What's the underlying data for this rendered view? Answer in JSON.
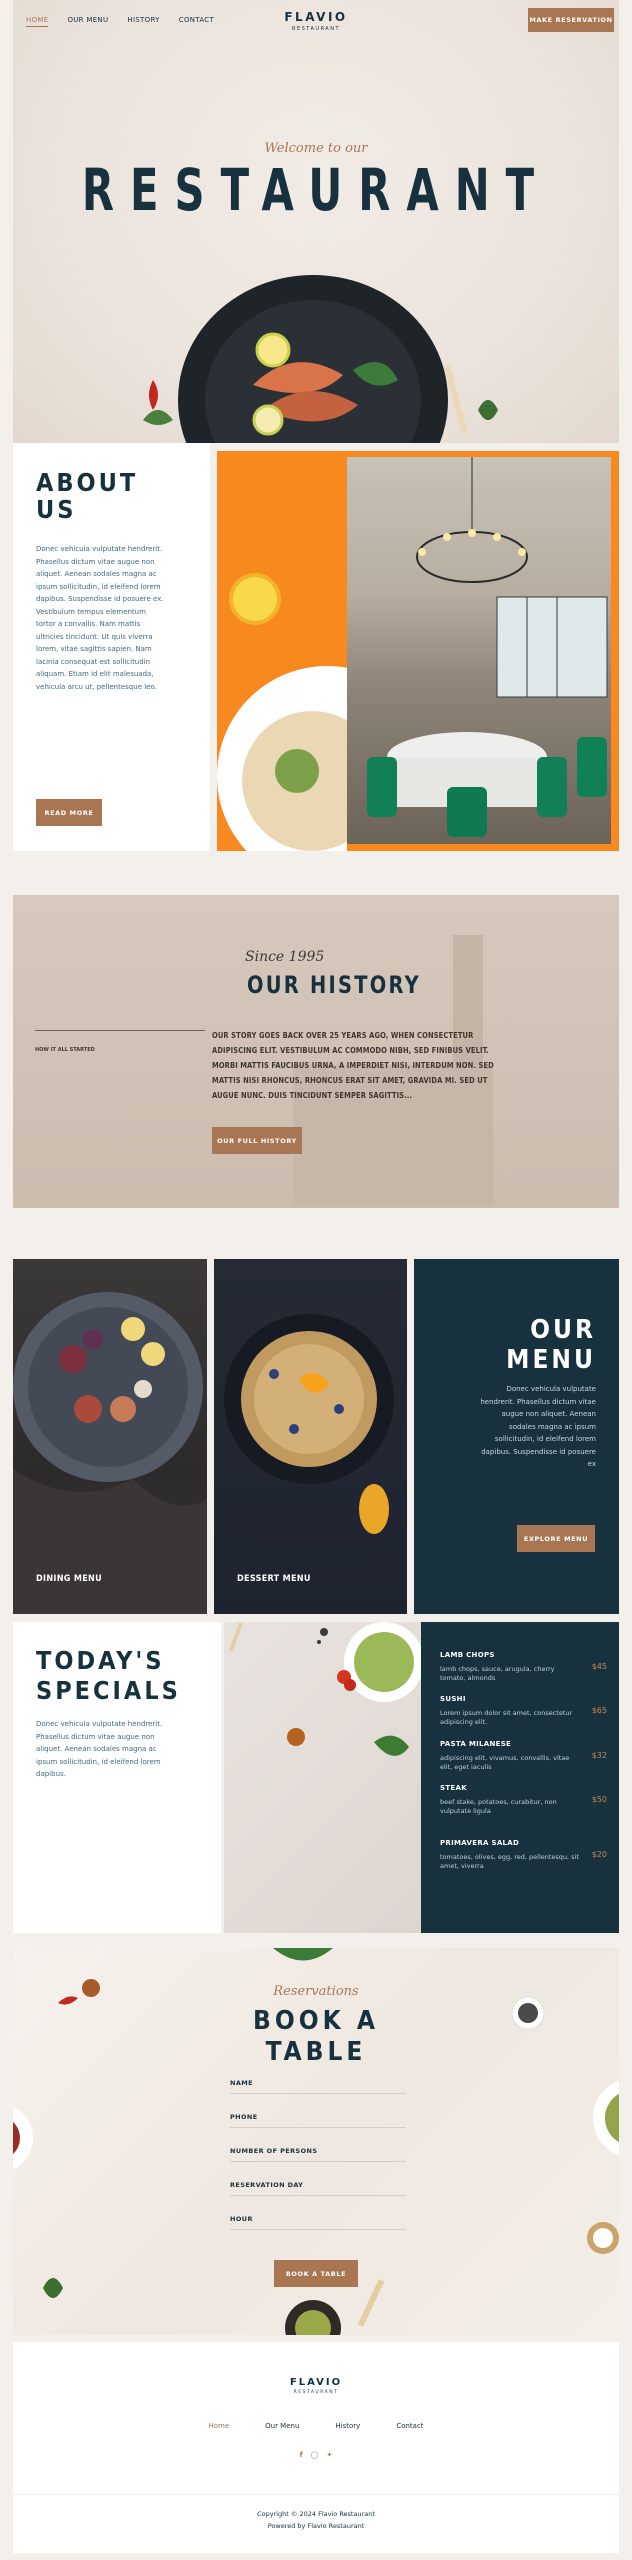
{
  "nav": {
    "items": [
      "HOME",
      "OUR MENU",
      "HISTORY",
      "CONTACT"
    ],
    "logo": "FLAVIO",
    "logo_sub": "RESTAURANT",
    "cta": "MAKE RESERVATION"
  },
  "hero": {
    "welcome": "Welcome to our",
    "title": "RESTAURANT"
  },
  "about": {
    "title_1": "ABOUT",
    "title_2": "US",
    "text": "Donec vehicula vulputate hendrerit. Phasellus dictum vitae augue non aliquet. Aenean sodales magna ac ipsum sollicitudin, id eleifend lorem dapibus. Suspendisse id posuere ex. Vestibulum tempus elementum tortor a convallis. Nam mattis ultricies tincidunt. Ut quis viverra lorem, vitae sagittis sapien. Nam lacinia consequat est sollicitudin aliquam. Etiam id elit malesuada, vehicula arcu ut, pellentesque leo.",
    "button": "READ MORE"
  },
  "history": {
    "since": "Since 1995",
    "title": "OUR HISTORY",
    "side_label": "HOW IT ALL STARTED",
    "text": "OUR STORY GOES BACK OVER 25 YEARS AGO, WHEN CONSECTETUR ADIPISCING ELIT. VESTIBULUM AC COMMODO NIBH, SED FINIBUS VELIT. MORBI MATTIS FAUCIBUS URNA, A IMPERDIET NISI, INTERDUM NON. SED MATTIS NISI RHONCUS, RHONCUS ERAT SIT AMET, GRAVIDA MI. SED UT AUGUE NUNC. DUIS TINCIDUNT SEMPER SAGITTIS...",
    "button": "OUR FULL HISTORY"
  },
  "menu_section": {
    "card_1": "DINING MENU",
    "card_2": "DESSERT MENU",
    "title_1": "OUR",
    "title_2": "MENU",
    "text": "Donec vehicula vulputate hendrerit. Phasellus dictum vitae augue non aliquet. Aenean sodales magna ac ipsum sollicitudin, id eleifend lorem dapibus. Suspendisse id posuere ex",
    "button": "EXPLORE MENU"
  },
  "specials": {
    "title_1": "TODAY'S",
    "title_2": "SPECIALS",
    "text": "Donec vehicula vulputate hendrerit. Phasellus dictum vitae augue non aliquet. Aenean sodales magna ac ipsum sollicitudin, id eleifend lorem dapibus.",
    "items": [
      {
        "name": "LAMB CHOPS",
        "desc": "lamb chops, sauce, arugula, cherry tomato, almonds",
        "price": "$45"
      },
      {
        "name": "SUSHI",
        "desc": "Lorem ipsum dolor sit amet, consectetur adipiscing elit.",
        "price": "$65"
      },
      {
        "name": "PASTA MILANESE",
        "desc": "adipiscing elit, vivamus, convallis, vitae elit, eget iaculis",
        "price": "$32"
      },
      {
        "name": "STEAK",
        "desc": "beef stake, potatoes, curabitur, non vulputate ligula",
        "price": "$50"
      },
      {
        "name": "PRIMAVERA SALAD",
        "desc": "tomatoes, olives, egg, red, pellentesqu, sit amet, viverra",
        "price": "$20"
      }
    ]
  },
  "reservation": {
    "script": "Reservations",
    "title_1": "BOOK A",
    "title_2": "TABLE",
    "fields": [
      "NAME",
      "PHONE",
      "NUMBER OF PERSONS",
      "RESERVATION DAY",
      "HOUR"
    ],
    "button": "BOOK A TABLE"
  },
  "footer": {
    "logo": "FLAVIO",
    "logo_sub": "RESTAURANT",
    "links": [
      "Home",
      "Our Menu",
      "History",
      "Contact"
    ],
    "social": [
      "facebook-icon",
      "instagram-icon",
      "twitter-icon"
    ],
    "copyright": "Copyright © 2024 Flavio Restaurant",
    "powered": "Powered by Flavio Restaurant"
  },
  "colors": {
    "navy": "#17313f",
    "accent": "#a97654",
    "orange": "#f7891f",
    "price": "#c8884f"
  }
}
